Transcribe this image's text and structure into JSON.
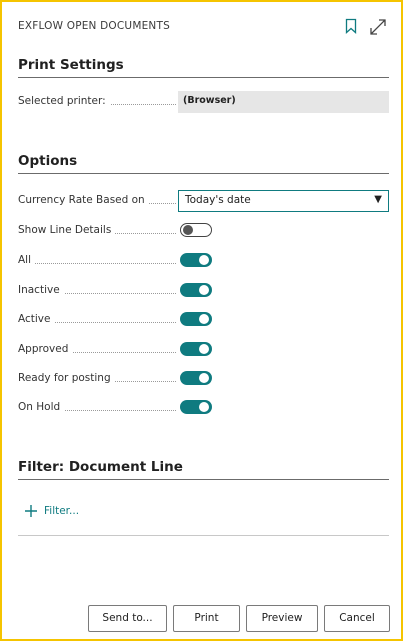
{
  "dialog": {
    "title": "EXFLOW OPEN DOCUMENTS",
    "icons": [
      "bookmark-icon",
      "expand-icon"
    ]
  },
  "print_settings": {
    "header": "Print Settings",
    "selected_printer_label": "Selected printer:",
    "selected_printer_value": "(Browser)"
  },
  "options": {
    "header": "Options",
    "currency_rate_label": "Currency Rate Based on",
    "currency_rate_value": "Today's date",
    "toggles": [
      {
        "label": "Show Line Details",
        "on": false
      },
      {
        "label": "All",
        "on": true
      },
      {
        "label": "Inactive",
        "on": true
      },
      {
        "label": "Active",
        "on": true
      },
      {
        "label": "Approved",
        "on": true
      },
      {
        "label": "Ready for posting",
        "on": true
      },
      {
        "label": "On Hold",
        "on": true
      }
    ]
  },
  "filter": {
    "header": "Filter: Document Line",
    "link_label": "Filter..."
  },
  "buttons": {
    "send_to": "Send to...",
    "print": "Print",
    "preview": "Preview",
    "cancel": "Cancel"
  },
  "colors": {
    "accent": "#0f7b80",
    "frame": "#f5c400"
  }
}
